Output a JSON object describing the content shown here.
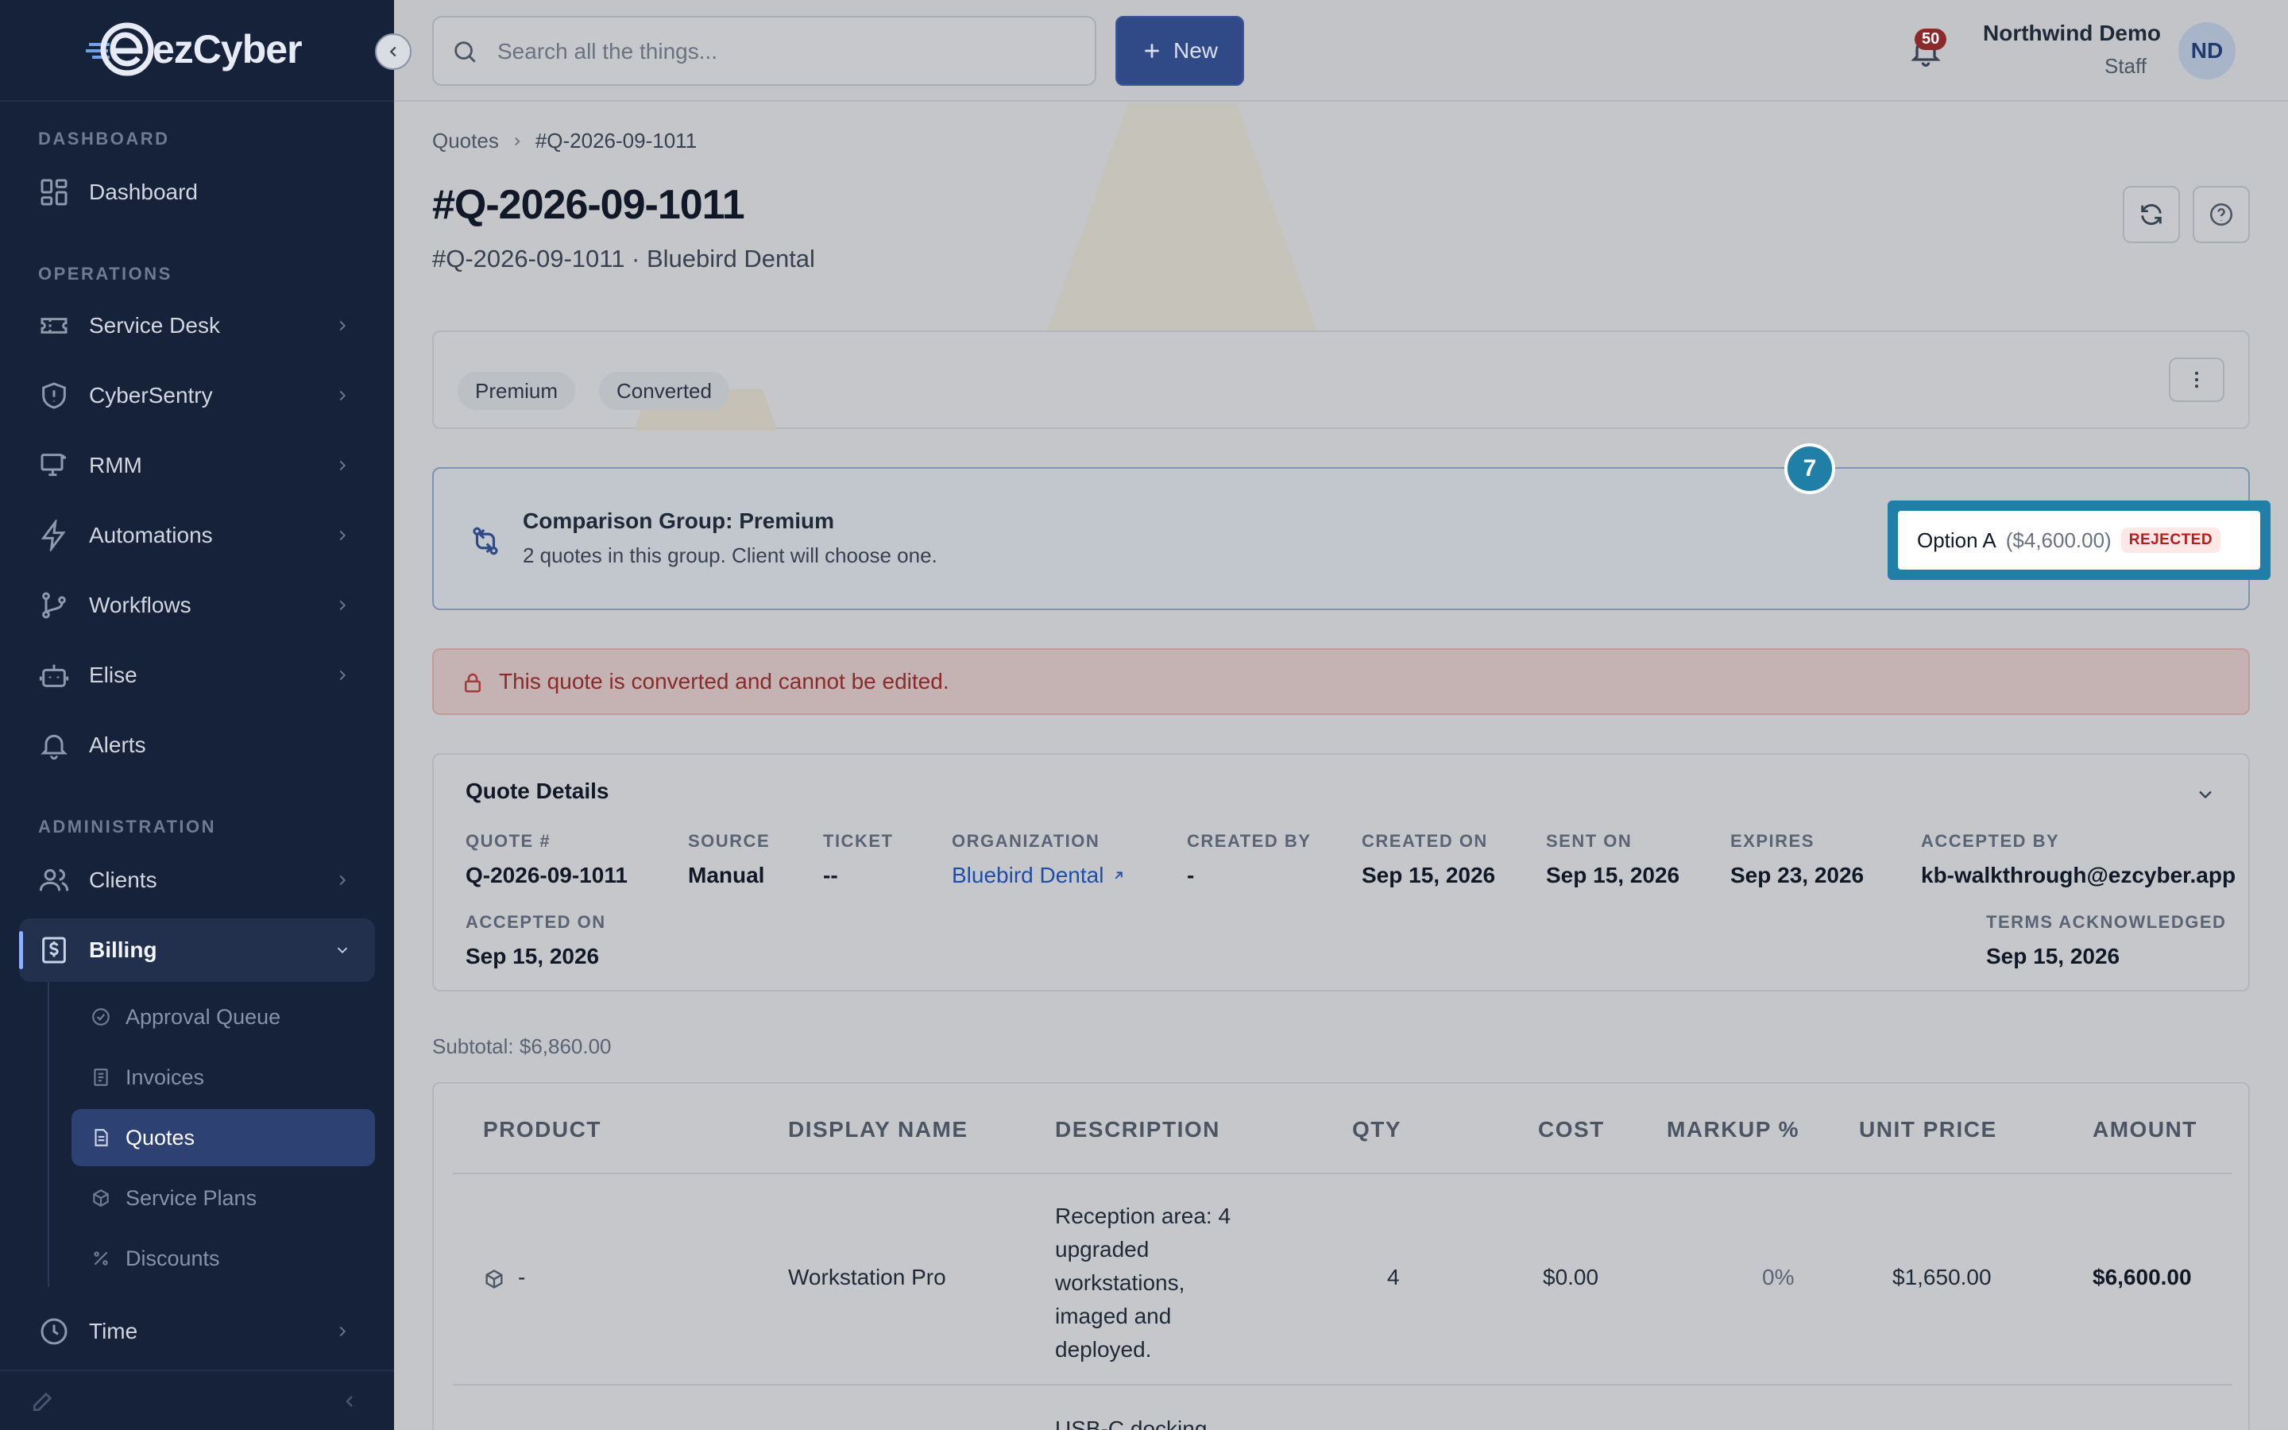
{
  "sidebar": {
    "logo_text": "ezCyber",
    "sections": {
      "dashboard": "DASHBOARD",
      "operations": "OPERATIONS",
      "administration": "ADMINISTRATION"
    },
    "items": [
      {
        "label": "Dashboard",
        "icon": "grid-icon"
      },
      {
        "label": "Service Desk",
        "icon": "ticket-icon"
      },
      {
        "label": "CyberSentry",
        "icon": "shield-icon"
      },
      {
        "label": "RMM",
        "icon": "monitor-icon"
      },
      {
        "label": "Automations",
        "icon": "bolt-icon"
      },
      {
        "label": "Workflows",
        "icon": "branch-icon"
      },
      {
        "label": "Elise",
        "icon": "robot-icon"
      },
      {
        "label": "Alerts",
        "icon": "bell-icon"
      },
      {
        "label": "Clients",
        "icon": "users-icon"
      },
      {
        "label": "Billing",
        "icon": "dollar-doc-icon"
      },
      {
        "label": "Time",
        "icon": "clock-icon"
      }
    ],
    "billing_sub": [
      {
        "label": "Approval Queue",
        "icon": "check-circle-icon"
      },
      {
        "label": "Invoices",
        "icon": "document-icon"
      },
      {
        "label": "Quotes",
        "icon": "document-icon"
      },
      {
        "label": "Service Plans",
        "icon": "cube-icon"
      },
      {
        "label": "Discounts",
        "icon": "percent-icon"
      }
    ]
  },
  "topbar": {
    "search_placeholder": "Search all the things...",
    "new_label": "New",
    "notification_count": "50",
    "user_name": "Northwind Demo",
    "user_role": "Staff",
    "avatar_initials": "ND"
  },
  "breadcrumb": {
    "parent": "Quotes",
    "current": "#Q-2026-09-1011"
  },
  "page": {
    "title": "#Q-2026-09-1011",
    "subtitle": "#Q-2026-09-1011 · Bluebird Dental"
  },
  "tags": [
    "Premium",
    "Converted"
  ],
  "comparison": {
    "title": "Comparison Group: Premium",
    "description": "2 quotes in this group. Client will choose one.",
    "option_label": "Option A",
    "option_price": "($4,600.00)",
    "option_status": "REJECTED",
    "step_number": "7"
  },
  "alert_text": "This quote is converted and cannot be edited.",
  "details": {
    "title": "Quote Details",
    "fields": {
      "quote_label": "QUOTE #",
      "quote_value": "Q-2026-09-1011",
      "source_label": "SOURCE",
      "source_value": "Manual",
      "ticket_label": "TICKET",
      "ticket_value": "--",
      "org_label": "ORGANIZATION",
      "org_value": "Bluebird Dental",
      "created_by_label": "CREATED BY",
      "created_by_value": "-",
      "created_on_label": "CREATED ON",
      "created_on_value": "Sep 15, 2026",
      "sent_on_label": "SENT ON",
      "sent_on_value": "Sep 15, 2026",
      "expires_label": "EXPIRES",
      "expires_value": "Sep 23, 2026",
      "accepted_by_label": "ACCEPTED BY",
      "accepted_by_value": "kb-walkthrough@ezcyber.app",
      "accepted_on_label": "ACCEPTED ON",
      "accepted_on_value": "Sep 15, 2026",
      "terms_label": "TERMS ACKNOWLEDGED",
      "terms_value": "Sep 15, 2026"
    }
  },
  "subtotal": "Subtotal: $6,860.00",
  "table": {
    "headers": [
      "PRODUCT",
      "DISPLAY NAME",
      "DESCRIPTION",
      "QTY",
      "COST",
      "MARKUP %",
      "UNIT PRICE",
      "AMOUNT"
    ],
    "rows": [
      {
        "product": "-",
        "display_name": "Workstation Pro",
        "description": "Reception area: 4 upgraded workstations, imaged and deployed.",
        "qty": "4",
        "cost": "$0.00",
        "markup": "0%",
        "unit_price": "$1,650.00",
        "amount": "$6,600.00"
      },
      {
        "product": "",
        "display_name": "",
        "description": "USB-C docking",
        "qty": "",
        "cost": "",
        "markup": "",
        "unit_price": "",
        "amount": ""
      }
    ]
  },
  "colors": {
    "sidebar_bg": "#16213a",
    "accent_blue": "#2f4a86",
    "highlight_teal": "#1f7fa6",
    "rejected_red": "#b91c1c"
  }
}
